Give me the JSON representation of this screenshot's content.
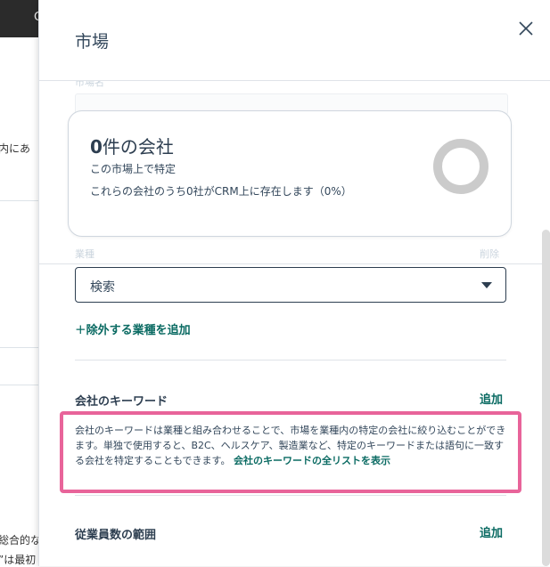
{
  "background": {
    "topbar_char": "C",
    "snippets": [
      "内にあ",
      "総合的な",
      "”は最初"
    ]
  },
  "panel": {
    "title": "市場",
    "close_icon": "close-icon"
  },
  "faint": {
    "top_label": "市場名",
    "label": "業種",
    "right_label": "削除"
  },
  "summary": {
    "count": "0",
    "count_suffix": "件の会社",
    "line1": "この市場上で特定",
    "line2": "これらの会社のうち0社がCRM上に存在します（0%）",
    "donut_color": "#cbcbcb",
    "percent_in_crm": 0
  },
  "industry": {
    "select_value": "検索",
    "add_exclude_plus": "+",
    "add_exclude_label": "除外する業種を追加"
  },
  "keywords": {
    "title": "会社のキーワード",
    "add_label": "追加",
    "description": "会社のキーワードは業種と組み合わせることで、市場を業種内の特定の会社に絞り込むことができます。単独で使用すると、B2C、ヘルスケア、製造業など、特定のキーワードまたは語句に一致する会社を特定することもできます。",
    "link_label": "会社のキーワードの全リストを表示",
    "highlight_color": "#e8649a"
  },
  "employees": {
    "title": "従業員数の範囲",
    "add_label": "追加"
  },
  "colors": {
    "accent": "#0b6b63",
    "text": "#2d3e50"
  }
}
